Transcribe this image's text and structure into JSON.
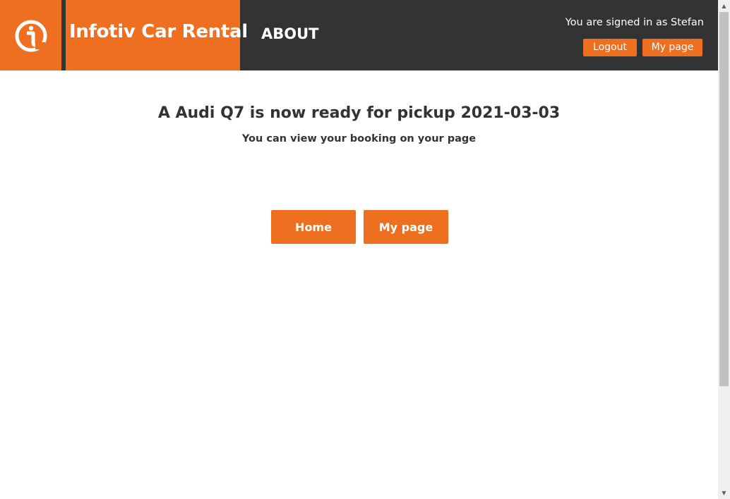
{
  "header": {
    "brand_title": "Infotiv Car Rental",
    "nav_about": "ABOUT",
    "signed_in_text": "You are signed in as Stefan",
    "logout_label": "Logout",
    "mypage_label": "My page"
  },
  "main": {
    "title": "A Audi Q7 is now ready for pickup 2021-03-03",
    "subtitle": "You can view your booking on your page",
    "home_label": "Home",
    "mypage_label": "My page"
  },
  "colors": {
    "accent": "#ee6f1f",
    "header_bg": "#333333",
    "text": "#333333"
  },
  "icons": {
    "logo": "infotiv-logo-icon",
    "scroll_up": "scroll-up-arrow-icon",
    "scroll_down": "scroll-down-arrow-icon"
  }
}
